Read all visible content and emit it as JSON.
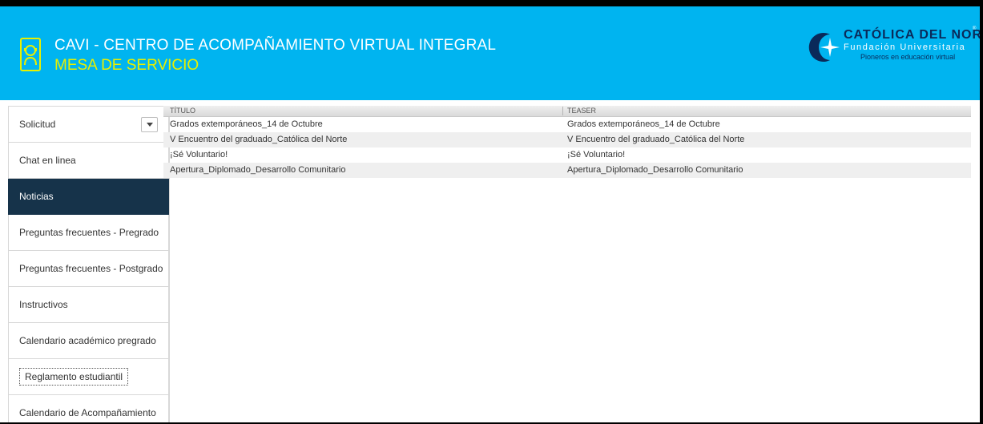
{
  "header": {
    "title_line1": "CAVI - CENTRO DE ACOMPAÑAMIENTO VIRTUAL INTEGRAL",
    "title_line2": "MESA DE SERVICIO",
    "bg_color": "#00b4f0",
    "accent_color": "#e8f000",
    "logo": {
      "name": "CATÓLICA DEL NORTE",
      "sub": "Fundación Universitaria",
      "tagline": "Pioneros en educación virtual",
      "reg": "®"
    }
  },
  "sidebar": {
    "items": [
      {
        "label": "Solicitud",
        "has_dropdown": true
      },
      {
        "label": "Chat en linea"
      },
      {
        "label": "Noticias",
        "active": true
      },
      {
        "label": "Preguntas frecuentes - Pregrado"
      },
      {
        "label": "Preguntas frecuentes - Postgrado"
      },
      {
        "label": "Instructivos"
      },
      {
        "label": "Calendario académico pregrado"
      },
      {
        "label": "Reglamento estudiantil",
        "button": true
      },
      {
        "label": "Calendario de Acompañamiento"
      }
    ],
    "active_color": "#16334a"
  },
  "grid": {
    "columns": [
      "TÍTULO",
      "TEASER"
    ],
    "rows": [
      [
        "Grados extemporáneos_14 de Octubre",
        "Grados extemporáneos_14 de Octubre"
      ],
      [
        "V Encuentro del graduado_Católica del Norte",
        "V Encuentro del graduado_Católica del Norte"
      ],
      [
        "¡Sé Voluntario!",
        "¡Sé Voluntario!"
      ],
      [
        "Apertura_Diplomado_Desarrollo Comunitario",
        "Apertura_Diplomado_Desarrollo Comunitario"
      ]
    ]
  }
}
